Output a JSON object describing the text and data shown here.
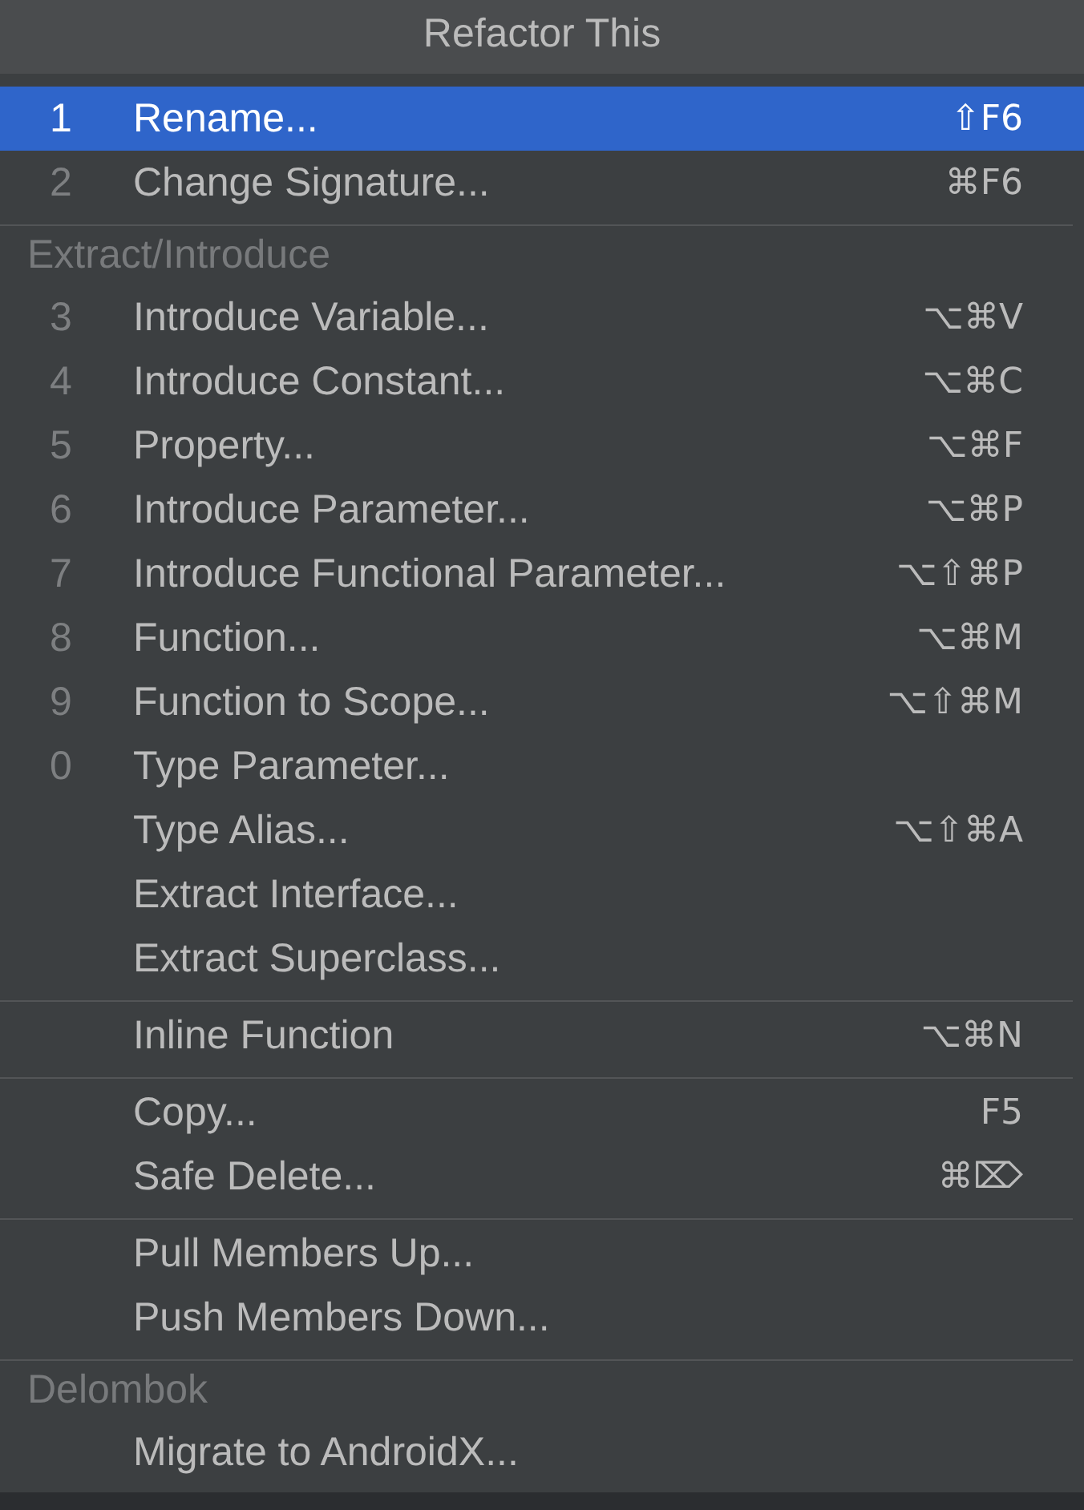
{
  "window": {
    "title": "Refactor This"
  },
  "menu": {
    "sections": [
      {
        "items": [
          {
            "number": "1",
            "label": "Rename...",
            "shortcut": "⇧F6",
            "selected": true
          },
          {
            "number": "2",
            "label": "Change Signature...",
            "shortcut": "⌘F6",
            "selected": false
          }
        ]
      },
      {
        "header": "Extract/Introduce",
        "items": [
          {
            "number": "3",
            "label": "Introduce Variable...",
            "shortcut": "⌥⌘V",
            "selected": false
          },
          {
            "number": "4",
            "label": "Introduce Constant...",
            "shortcut": "⌥⌘C",
            "selected": false
          },
          {
            "number": "5",
            "label": "Property...",
            "shortcut": "⌥⌘F",
            "selected": false
          },
          {
            "number": "6",
            "label": "Introduce Parameter...",
            "shortcut": "⌥⌘P",
            "selected": false
          },
          {
            "number": "7",
            "label": "Introduce Functional Parameter...",
            "shortcut": "⌥⇧⌘P",
            "selected": false
          },
          {
            "number": "8",
            "label": "Function...",
            "shortcut": "⌥⌘M",
            "selected": false
          },
          {
            "number": "9",
            "label": "Function to Scope...",
            "shortcut": "⌥⇧⌘M",
            "selected": false
          },
          {
            "number": "0",
            "label": "Type Parameter...",
            "selected": false
          },
          {
            "label": "Type Alias...",
            "shortcut": "⌥⇧⌘A",
            "selected": false
          },
          {
            "label": "Extract Interface...",
            "selected": false
          },
          {
            "label": "Extract Superclass...",
            "selected": false
          }
        ]
      },
      {
        "items": [
          {
            "label": "Inline Function",
            "shortcut": "⌥⌘N",
            "selected": false
          }
        ]
      },
      {
        "items": [
          {
            "label": "Copy...",
            "shortcut": "F5",
            "selected": false
          },
          {
            "label": "Safe Delete...",
            "shortcut": "⌘⌦",
            "selected": false
          }
        ]
      },
      {
        "items": [
          {
            "label": "Pull Members Up...",
            "selected": false
          },
          {
            "label": "Push Members Down...",
            "selected": false
          }
        ]
      },
      {
        "header": "Delombok",
        "items": [
          {
            "label": "Migrate to AndroidX...",
            "selected": false
          }
        ]
      }
    ]
  }
}
